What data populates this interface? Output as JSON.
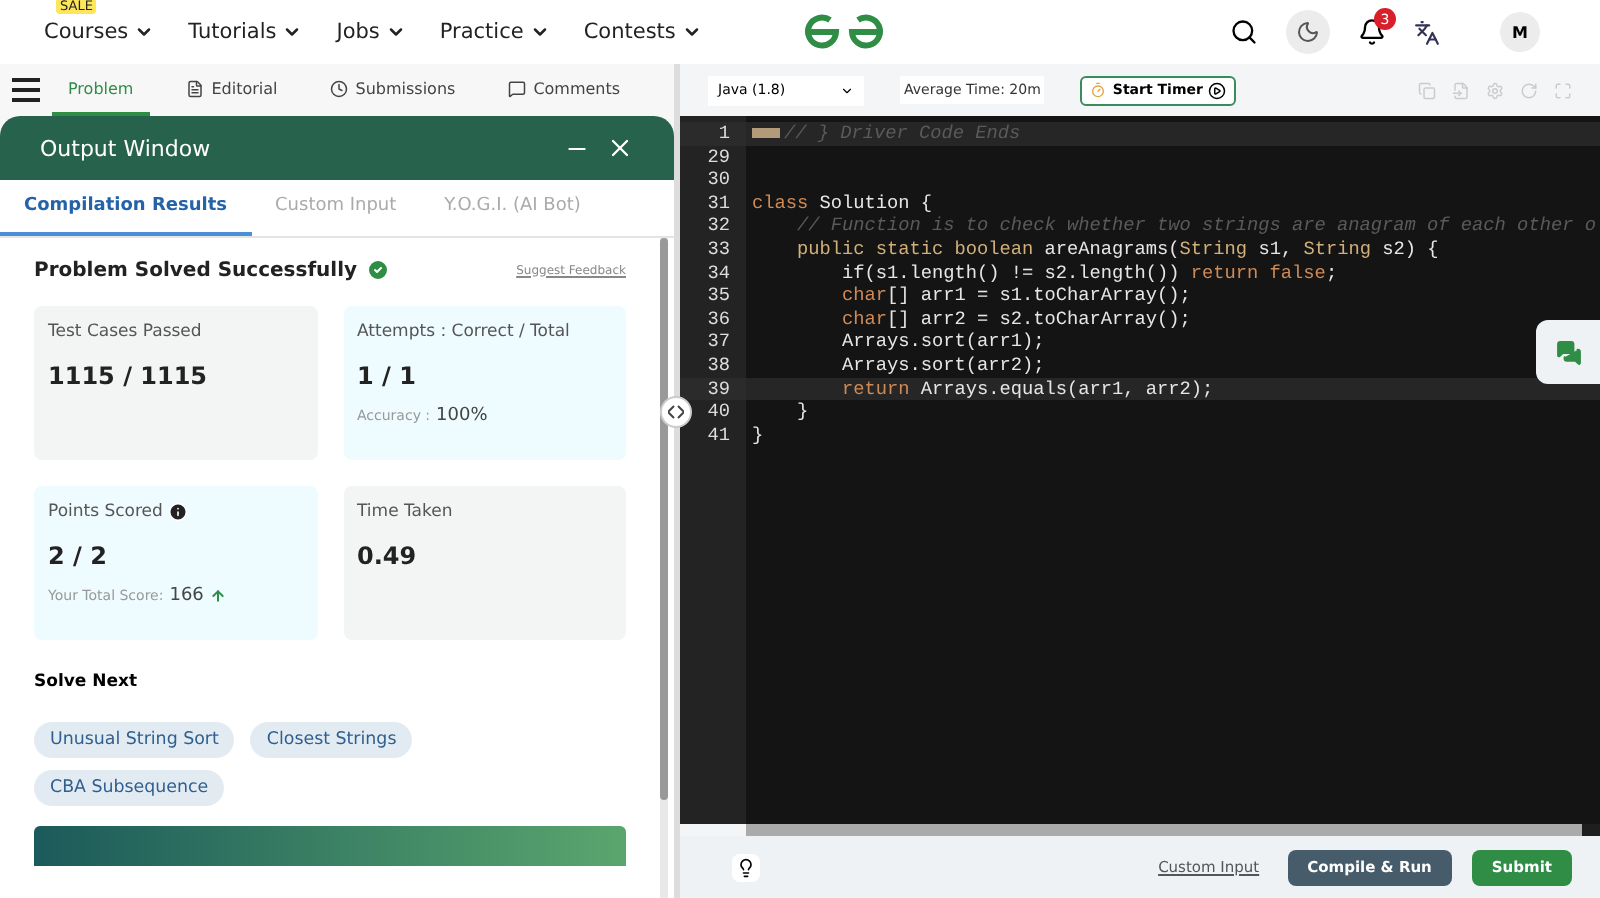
{
  "topnav": {
    "sale_badge": "SALE",
    "items": [
      "Courses",
      "Tutorials",
      "Jobs",
      "Practice",
      "Contests"
    ],
    "notification_count": "3",
    "avatar": "M"
  },
  "problem_tabs": [
    {
      "label": "Problem",
      "selected": true
    },
    {
      "label": "Editorial",
      "selected": false
    },
    {
      "label": "Submissions",
      "selected": false
    },
    {
      "label": "Comments",
      "selected": false
    }
  ],
  "output_window": {
    "title": "Output Window",
    "tabs": [
      {
        "label": "Compilation Results",
        "selected": true
      },
      {
        "label": "Custom Input",
        "selected": false
      },
      {
        "label": "Y.O.G.I. (AI Bot)",
        "selected": false
      }
    ],
    "status": "Problem Solved Successfully",
    "feedback_link": "Suggest Feedback",
    "stats": [
      {
        "label": "Test Cases Passed",
        "value": "1115 / 1115",
        "tinted": false,
        "info": false
      },
      {
        "label": "Attempts : Correct / Total",
        "value": "1 / 1",
        "note_label": "Accuracy :",
        "note_value": "100%",
        "tinted": true,
        "info": false
      },
      {
        "label": "Points Scored",
        "value": "2 / 2",
        "note_label": "Your Total Score:",
        "note_value": "166",
        "tinted": true,
        "info": true
      },
      {
        "label": "Time Taken",
        "value": "0.49",
        "tinted": false,
        "info": false
      }
    ],
    "solve_next_title": "Solve Next",
    "suggestions": [
      "Unusual String Sort",
      "Closest Strings",
      "CBA Subsequence"
    ]
  },
  "editor": {
    "language": "Java (1.8)",
    "average_time": "Average Time: 20m",
    "timer_button": "Start Timer",
    "lines": [
      {
        "number": "1",
        "folded": true,
        "highlighted": true,
        "tokens": [
          {
            "text": "// } Driver Code Ends",
            "kind": "comment"
          }
        ]
      },
      {
        "number": "29",
        "folded": false,
        "highlighted": false
      },
      {
        "number": "30",
        "folded": false,
        "highlighted": false
      },
      {
        "number": "31",
        "folded": false,
        "highlighted": false,
        "tokens": [
          {
            "text": "class",
            "kind": "keyword"
          },
          {
            "text": " Solution {",
            "kind": "plain"
          }
        ]
      },
      {
        "number": "32",
        "folded": false,
        "highlighted": false,
        "tokens": [
          {
            "text": "    // Function is to check whether two strings are anagram of each other o",
            "kind": "comment"
          }
        ]
      },
      {
        "number": "33",
        "folded": false,
        "highlighted": false,
        "tokens": [
          {
            "text": "    public static boolean",
            "kind": "type"
          },
          {
            "text": " areAnagrams(",
            "kind": "plain"
          },
          {
            "text": "String",
            "kind": "type"
          },
          {
            "text": " s1, ",
            "kind": "plain"
          },
          {
            "text": "String",
            "kind": "type"
          },
          {
            "text": " s2) {",
            "kind": "plain"
          }
        ]
      },
      {
        "number": "34",
        "folded": false,
        "highlighted": false,
        "tokens": [
          {
            "text": "        if(s1.length() != s2.length()) ",
            "kind": "plain"
          },
          {
            "text": "return false",
            "kind": "keyword"
          },
          {
            "text": ";",
            "kind": "plain"
          }
        ]
      },
      {
        "number": "35",
        "folded": false,
        "highlighted": false,
        "tokens": [
          {
            "text": "        char",
            "kind": "keyword"
          },
          {
            "text": "[] arr1 = s1.toCharArray();",
            "kind": "plain"
          }
        ]
      },
      {
        "number": "36",
        "folded": false,
        "highlighted": false,
        "tokens": [
          {
            "text": "        char",
            "kind": "keyword"
          },
          {
            "text": "[] arr2 = s2.toCharArray();",
            "kind": "plain"
          }
        ]
      },
      {
        "number": "37",
        "folded": false,
        "highlighted": false,
        "tokens": [
          {
            "text": "        Arrays.sort(arr1);",
            "kind": "plain"
          }
        ]
      },
      {
        "number": "38",
        "folded": false,
        "highlighted": false,
        "tokens": [
          {
            "text": "        Arrays.sort(arr2);",
            "kind": "plain"
          }
        ]
      },
      {
        "number": "39",
        "folded": false,
        "highlighted": true,
        "tokens": [
          {
            "text": "        return",
            "kind": "keyword"
          },
          {
            "text": " Arrays.equals(arr1, arr2);",
            "kind": "plain"
          }
        ]
      },
      {
        "number": "40",
        "folded": false,
        "highlighted": false,
        "tokens": [
          {
            "text": "    }",
            "kind": "plain"
          }
        ]
      },
      {
        "number": "41",
        "folded": false,
        "highlighted": false,
        "tokens": [
          {
            "text": "}",
            "kind": "plain"
          }
        ]
      }
    ]
  },
  "footer": {
    "custom_input": "Custom Input",
    "compile_button": "Compile & Run",
    "submit_button": "Submit"
  }
}
